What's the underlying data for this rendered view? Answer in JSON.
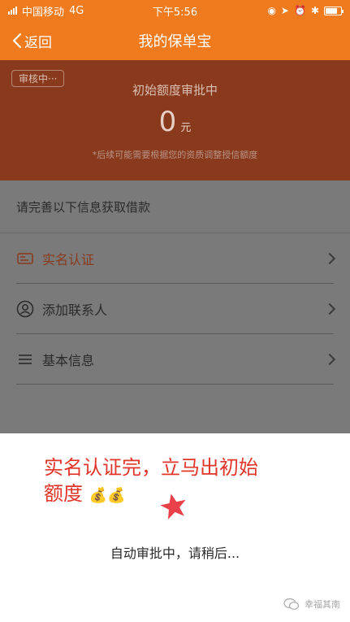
{
  "status_bar": {
    "carrier": "中国移动",
    "network": "4G",
    "time": "下午5:56",
    "battery_level": 0.8
  },
  "nav": {
    "back_label": "返回",
    "title": "我的保单宝"
  },
  "header": {
    "badge": "审核中···",
    "title": "初始额度审批中",
    "amount": "0",
    "unit": "元",
    "note": "*后续可能需要根据您的资质调整授信额度"
  },
  "info": {
    "prompt": "请完善以下信息获取借款",
    "items": [
      {
        "label": "实名认证",
        "icon": "id-card-icon"
      },
      {
        "label": "添加联系人",
        "icon": "contact-icon"
      },
      {
        "label": "基本信息",
        "icon": "list-icon"
      }
    ]
  },
  "modal": {
    "promo_line1": "实名认证完，立马出初始",
    "promo_line2": "额度",
    "money_emoji": "💰💰",
    "processing": "自动审批中，请稍后...",
    "watermark": "幸福其南"
  },
  "colors": {
    "orange": "#f07a1e",
    "header_dim": "#8a3a1c",
    "overlay_grey": "#7a7a7a",
    "promo_red": "#e1352a"
  }
}
